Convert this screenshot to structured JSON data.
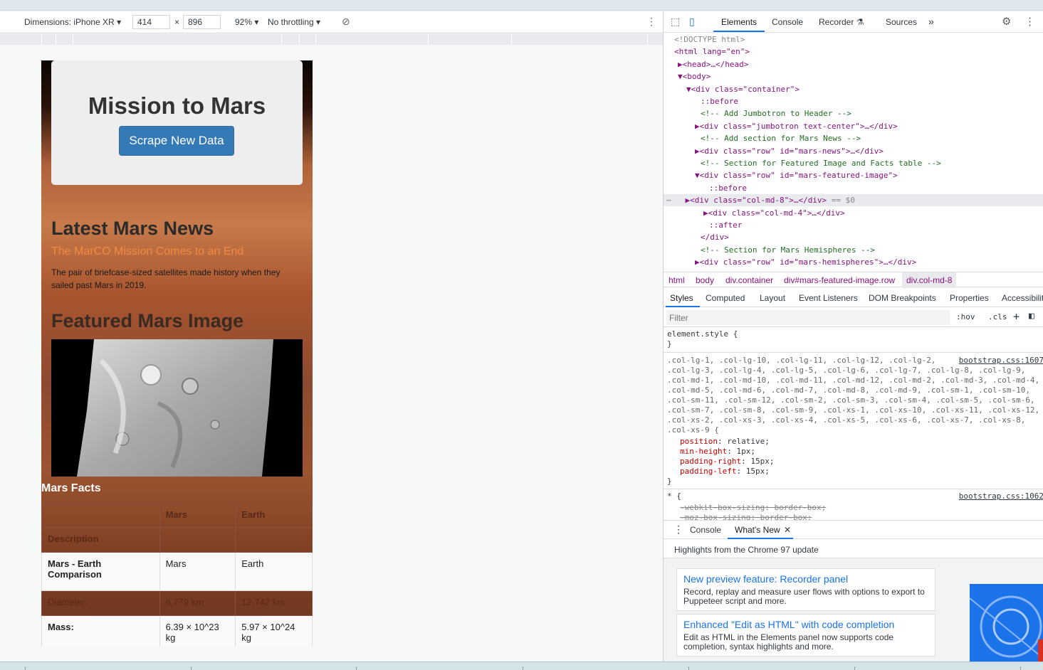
{
  "device_toolbar": {
    "dimensions_label": "Dimensions: iPhone XR",
    "width_value": "414",
    "times": "×",
    "height_value": "896",
    "zoom": "92%",
    "throttling": "No throttling"
  },
  "page": {
    "title": "Mission to Mars",
    "scrape_button": "Scrape New Data",
    "news_heading": "Latest Mars News",
    "news_title": "The MarCO Mission Comes to an End",
    "news_paragraph": "The pair of briefcase-sized satellites made history when they sailed past Mars in 2019.",
    "featured_heading": "Featured Mars Image",
    "facts_heading": "Mars Facts",
    "facts_table": {
      "headers": [
        "",
        "Mars",
        "Earth"
      ],
      "index_label": "Description",
      "rows": [
        [
          "Mars - Earth Comparison",
          "Mars",
          "Earth"
        ],
        [
          "Diameter:",
          "6,779 km",
          "12,742 km"
        ],
        [
          "Mass:",
          "6.39 × 10^23 kg",
          "5.97 × 10^24 kg"
        ]
      ]
    }
  },
  "devtools": {
    "tabs": [
      "Elements",
      "Console",
      "Recorder",
      "Sources",
      "»"
    ],
    "dom": {
      "doctype": "<!DOCTYPE html>",
      "html_open": "<html lang=\"en\">",
      "head": "<head>…</head>",
      "body_open": "<body>",
      "container_open": "<div class=\"container\">",
      "before": "::before",
      "comment_jumbotron": "<!-- Add Jumbotron to Header -->",
      "jumbotron": "<div class=\"jumbotron text-center\">…</div>",
      "comment_news": "<!-- Add section for Mars News -->",
      "mars_news": "<div class=\"row\" id=\"mars-news\">…</div>",
      "comment_featured": "<!-- Section for Featured Image and Facts table -->",
      "featured_open": "<div class=\"row\" id=\"mars-featured-image\">",
      "before2": "::before",
      "col_md_8": "<div class=\"col-md-8\">…</div>",
      "selected_marker": "== $0",
      "col_md_4": "<div class=\"col-md-4\">…</div>",
      "after": "::after",
      "div_close": "</div>",
      "comment_hemispheres": "<!-- Section for Mars Hemispheres -->",
      "hemispheres": "<div class=\"row\" id=\"mars-hemispheres\">…</div>"
    },
    "breadcrumbs": [
      "html",
      "body",
      "div.container",
      "div#mars-featured-image.row",
      "div.col-md-8"
    ],
    "style_tabs": [
      "Styles",
      "Computed",
      "Layout",
      "Event Listeners",
      "DOM Breakpoints",
      "Properties",
      "Accessibility"
    ],
    "filter_placeholder": "Filter",
    "filter_hov": ":hov",
    "filter_cls": ".cls",
    "styles": {
      "element_style": "element.style {",
      "close": "}",
      "source1": "bootstrap.css:1607",
      "selector_lines": [
        ".col-lg-1, .col-lg-10, .col-lg-11, .col-lg-12, .col-lg-2,",
        ".col-lg-3, .col-lg-4, .col-lg-5, .col-lg-6, .col-lg-7, .col-lg-8, .col-lg-9,",
        ".col-md-1, .col-md-10, .col-md-11, .col-md-12, .col-md-2, .col-md-3, .col-md-4,",
        ".col-md-5, .col-md-6, .col-md-7, .col-md-8, .col-md-9, .col-sm-1, .col-sm-10,",
        ".col-sm-11, .col-sm-12, .col-sm-2, .col-sm-3, .col-sm-4, .col-sm-5, .col-sm-6,",
        ".col-sm-7, .col-sm-8, .col-sm-9, .col-xs-1, .col-xs-10, .col-xs-11, .col-xs-12,",
        ".col-xs-2, .col-xs-3, .col-xs-4, .col-xs-5, .col-xs-6, .col-xs-7, .col-xs-8,",
        ".col-xs-9 {"
      ],
      "declarations": [
        {
          "prop": "position",
          "value": "relative;"
        },
        {
          "prop": "min-height",
          "value": "1px;"
        },
        {
          "prop": "padding-right",
          "value": "15px;"
        },
        {
          "prop": "padding-left",
          "value": "15px;"
        }
      ],
      "universal_selector": "* {",
      "source2": "bootstrap.css:1062",
      "strike1": "-webkit-box-sizing: border-box;",
      "strike2": "-moz-box-sizing: border-box;"
    },
    "drawer_tabs": [
      "Console",
      "What's New"
    ],
    "whats_new": {
      "header": "Highlights from the Chrome 97 update",
      "cards": [
        {
          "title": "New preview feature: Recorder panel",
          "desc": "Record, replay and measure user flows with options to export to Puppeteer script and more."
        },
        {
          "title": "Enhanced \"Edit as HTML\" with code completion",
          "desc": "Edit as HTML in the Elements panel now supports code completion, syntax highlights and more."
        }
      ]
    }
  }
}
